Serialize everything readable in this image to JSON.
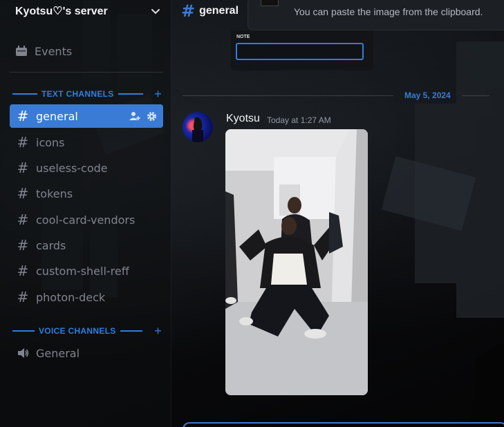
{
  "server": {
    "name": "Kyotsu♡'s server"
  },
  "sidebar": {
    "events_label": "Events",
    "text_category": "TEXT CHANNELS",
    "voice_category": "VOICE CHANNELS",
    "text_channels": [
      {
        "name": "general",
        "active": true
      },
      {
        "name": "icons"
      },
      {
        "name": "useless-code"
      },
      {
        "name": "tokens"
      },
      {
        "name": "cool-card-vendors"
      },
      {
        "name": "cards"
      },
      {
        "name": "custom-shell-reff"
      },
      {
        "name": "photon-deck"
      }
    ],
    "voice_channels": [
      {
        "name": "General"
      }
    ]
  },
  "topbar": {
    "channel": "general"
  },
  "upload": {
    "hint": "You can paste the image from the clipboard."
  },
  "note": {
    "label": "NOTE",
    "value": ""
  },
  "messages": {
    "date": "May 5, 2024",
    "author": "Kyotsu",
    "timestamp": "Today at 1:27 AM"
  },
  "colors": {
    "accent": "#3a7bd5",
    "muted": "#80848e",
    "text": "#dbdee1"
  },
  "icons": {
    "events": "calendar-icon",
    "chevron": "chevron-down-icon",
    "invite": "add-member-icon",
    "settings": "gear-icon",
    "text_channel": "hash-icon",
    "voice_channel": "speaker-icon",
    "add": "plus-icon"
  }
}
